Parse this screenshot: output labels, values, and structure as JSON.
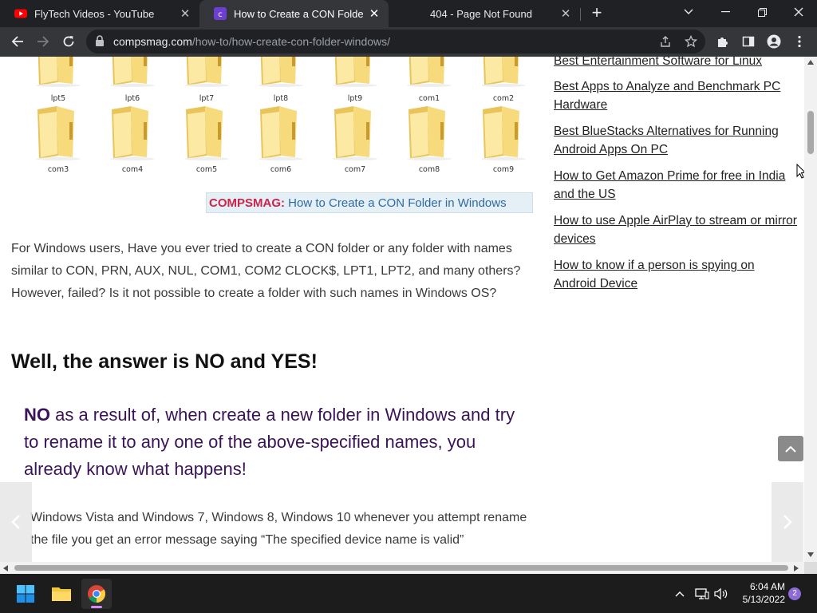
{
  "tabs": [
    {
      "title": "FlyTech Videos - YouTube",
      "active": false
    },
    {
      "title": "How to Create a CON Folder in W",
      "active": true
    },
    {
      "title": "404 - Page Not Found",
      "active": false
    }
  ],
  "address": {
    "host": "compsmag.com",
    "path": "/how-to/how-create-con-folder-windows/"
  },
  "folders": {
    "row1": [
      "lpt5",
      "lpt6",
      "lpt7",
      "lpt8",
      "lpt9",
      "com1",
      "com2"
    ],
    "row2": [
      "com3",
      "com4",
      "com5",
      "com6",
      "com7",
      "com8",
      "com9"
    ]
  },
  "caption": {
    "brand": "COMPSMAG:",
    "text": " How to Create a CON Folder in Windows"
  },
  "article": {
    "intro": "For Windows users, Have you ever tried to create a CON folder or any folder with names similar to CON, PRN, AUX, NUL, COM1, COM2 CLOCK$, LPT1, LPT2, and many others? However, failed? Is it not possible to create a folder with such names in Windows OS?",
    "heading": "Well, the answer is NO and YES!",
    "quote_strong": "NO",
    "quote_rest": " as a result of, when create a new folder in Windows and try to rename it to any one of the above-specified names, you already know what happens!",
    "para2": "Windows Vista and Windows 7, Windows 8, Windows 10 whenever you attempt rename the file you get an error message saying “The specified device name is valid”"
  },
  "sidebar": {
    "links": [
      "Best Entertainment Software for Linux",
      "Best Apps to Analyze and Benchmark PC Hardware",
      "Best BlueStacks Alternatives for Running Android Apps On PC",
      "How to Get Amazon Prime for free in India and the US",
      "How to use Apple AirPlay to stream or mirror devices",
      "How to know if a person is spying on Android Device"
    ]
  },
  "taskbar": {
    "time": "6:04 AM",
    "date": "5/13/2022",
    "notifications": "2"
  },
  "colors": {
    "chrome_bg": "#202124",
    "toolbar": "#35363a",
    "brand_red": "#d0234b",
    "quote_purple": "#3b1358"
  }
}
